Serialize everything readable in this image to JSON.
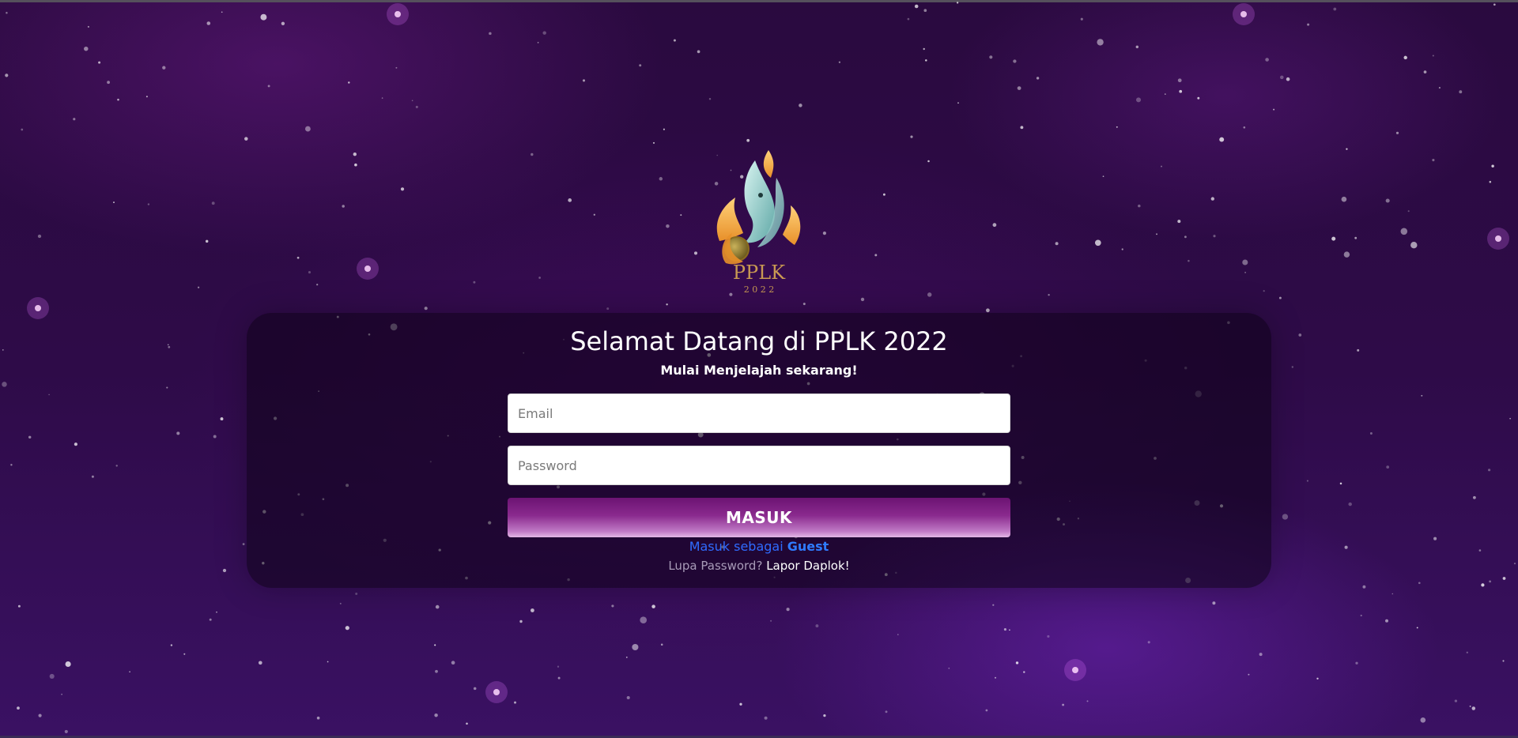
{
  "page": {
    "background_color": "#2e0b48",
    "accent_color": "#8a2a8e",
    "link_color": "#2f7bff"
  },
  "logo": {
    "icon": "flame-phoenix-logo-icon",
    "text": "PPLK",
    "year": "2 0 2 2"
  },
  "login": {
    "title": "Selamat Datang di PPLK 2022",
    "subtitle": "Mulai Menjelajah sekarang!",
    "email_placeholder": "Email",
    "email_value": "",
    "password_placeholder": "Password",
    "password_value": "",
    "submit_label": "MASUK",
    "guest_prefix": "Masuk sebagai ",
    "guest_link": "Guest",
    "forgot_prefix": "Lupa Password? ",
    "forgot_link": "Lapor Daplok!"
  }
}
